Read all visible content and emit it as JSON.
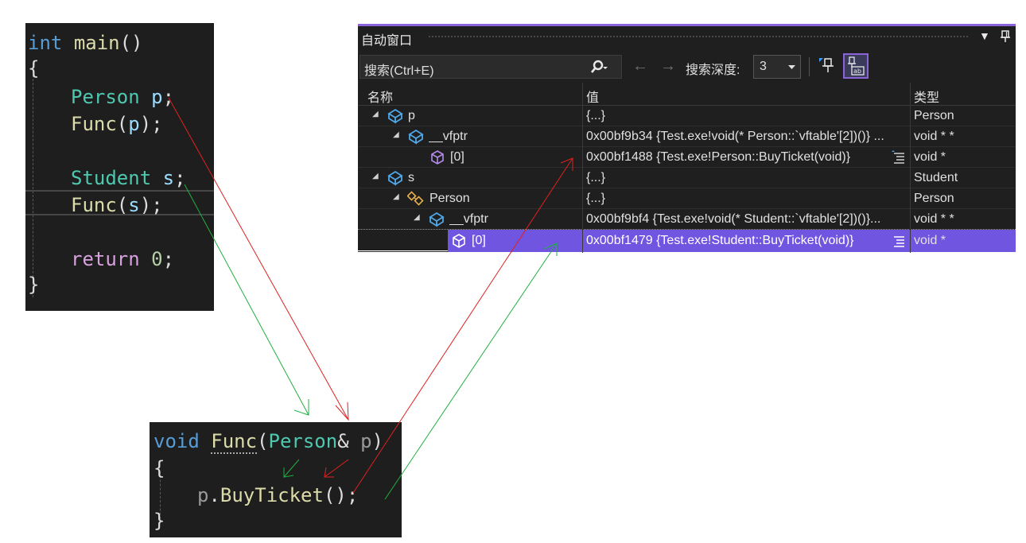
{
  "main_code": {
    "kw_int": "int",
    "fn_main": "main",
    "paren_main": "()",
    "open_brace": "{",
    "ty_person": "Person",
    "var_p": "p",
    "semi1": ";",
    "fn_func1": "Func",
    "call1_open": "(",
    "call1_arg": "p",
    "call1_close": ")",
    "semi2": ";",
    "ty_student": "Student",
    "var_s": "s",
    "semi3": ";",
    "fn_func2": "Func",
    "call2_open": "(",
    "call2_arg": "s",
    "call2_close": ")",
    "semi4": ";",
    "kw_return": "return",
    "num_zero": "0",
    "semi5": ";",
    "close_brace": "}"
  },
  "func_code": {
    "kw_void": "void",
    "fn_func": "Func",
    "paren_open": "(",
    "ty_person": "Person",
    "amp": "&",
    "param_p": "p",
    "paren_close": ")",
    "open_brace": "{",
    "obj_p": "p",
    "dot": ".",
    "fn_buy": "BuyTicket",
    "call_paren": "()",
    "semi": ";",
    "close_brace": "}"
  },
  "auto_window": {
    "title": "自动窗口",
    "dropdown_glyph": "▼",
    "pin_glyph": "ㅁ",
    "search_placeholder": "搜索(Ctrl+E)",
    "back_arrow": "←",
    "forward_arrow": "→",
    "depth_label": "搜索深度:",
    "depth_value": "3",
    "columns": {
      "name": "名称",
      "value": "值",
      "type": "类型"
    },
    "rows": [
      {
        "name": "p",
        "value": "{...}",
        "type": "Person"
      },
      {
        "name": "__vfptr",
        "value": "0x00bf9b34 {Test.exe!void(* Person::`vftable'[2])()} ...",
        "type": "void * *"
      },
      {
        "name": "[0]",
        "value": "0x00bf1488 {Test.exe!Person::BuyTicket(void)}",
        "type": "void *"
      },
      {
        "name": "s",
        "value": "{...}",
        "type": "Student"
      },
      {
        "name": "Person",
        "value": "{...}",
        "type": "Person"
      },
      {
        "name": "__vfptr",
        "value": "0x00bf9bf4 {Test.exe!void(* Student::`vftable'[2])()}...",
        "type": "void * *"
      },
      {
        "name": "[0]",
        "value": "0x00bf1479 {Test.exe!Student::BuyTicket(void)}",
        "type": "void *"
      }
    ]
  },
  "colors": {
    "red_arrow": "#e02020",
    "green_arrow": "#20b040",
    "selection": "#7055e0"
  }
}
